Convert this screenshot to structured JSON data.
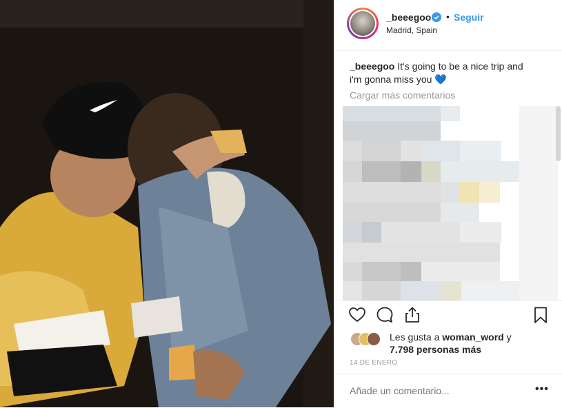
{
  "post": {
    "username": "_beeegoo",
    "follow_label": "Seguir",
    "separator": "•",
    "location": "Madrid, Spain",
    "caption_user": "_beeegoo",
    "caption_text": " It's going to be a nice trip and i'm gonna miss you ",
    "caption_emoji": "💙",
    "load_more": "Cargar más comentarios",
    "likes_prefix": "Les gusta a ",
    "likes_user": "woman_word",
    "likes_mid": " y",
    "likes_count": "7.798 personas más",
    "date": "14 DE ENERO",
    "comment_placeholder": "Añade un comentario...",
    "more_label": "•••"
  },
  "colors": {
    "link_blue": "#3897f0",
    "muted_gray": "#999999",
    "text": "#262626"
  },
  "icons": [
    "verified-badge-icon",
    "heart-icon",
    "comment-icon",
    "share-icon",
    "bookmark-icon",
    "more-options-icon"
  ]
}
